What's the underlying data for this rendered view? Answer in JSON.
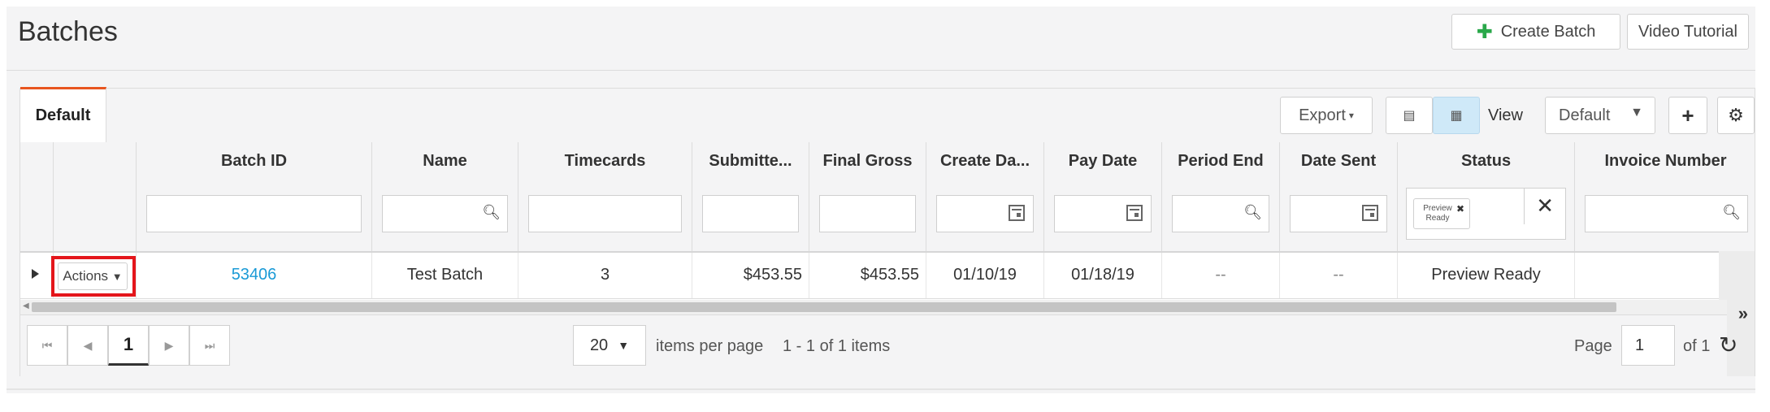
{
  "header": {
    "title": "Batches",
    "create_batch": "Create Batch",
    "video_tutorial": "Video Tutorial"
  },
  "toolbar": {
    "tab_default": "Default",
    "export": "Export",
    "view_label": "View",
    "view_value": "Default"
  },
  "columns": [
    "Batch ID",
    "Name",
    "Timecards",
    "Submitte...",
    "Final Gross",
    "Create Da...",
    "Pay Date",
    "Period End",
    "Date Sent",
    "Status",
    "Invoice Number"
  ],
  "status_filter": {
    "chip": "Preview Ready"
  },
  "row": {
    "actions": "Actions",
    "batch_id": "53406",
    "name": "Test Batch",
    "timecards": "3",
    "submitted": "$453.55",
    "final_gross": "$453.55",
    "create_date": "01/10/19",
    "pay_date": "01/18/19",
    "period_end": "--",
    "date_sent": "--",
    "status": "Preview Ready",
    "invoice_number": ""
  },
  "pager": {
    "current_page": "1",
    "page_size": "20",
    "items_per_page": "items per page",
    "range": "1 - 1 of 1 items",
    "page_label": "Page",
    "page_input": "1",
    "of_label": "of 1"
  },
  "colors": {
    "accent": "#e8551f",
    "link": "#1a9ad6",
    "green": "#2aa84a",
    "highlight": "#e4161b"
  }
}
